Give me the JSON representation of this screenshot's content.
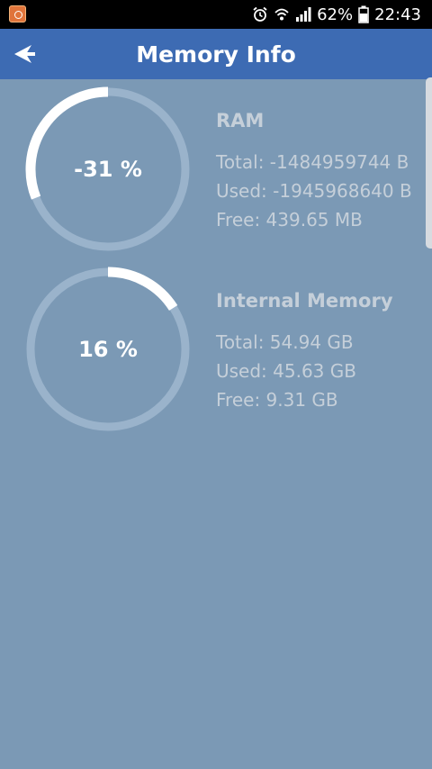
{
  "status_bar": {
    "battery_percent": "62%",
    "time": "22:43",
    "icons": [
      "app-notification-icon",
      "alarm-icon",
      "wifi-icon",
      "signal-icon",
      "battery-icon"
    ]
  },
  "app_bar": {
    "title": "Memory Info",
    "back_icon": "back-arrow-icon"
  },
  "ram": {
    "title": "RAM",
    "percent_label": "-31 %",
    "total": "Total: -1484959744 B",
    "used": "Used: -1945968640 B",
    "free": "Free: 439.65 MB",
    "gauge_fill_fraction": 0.31,
    "gauge_direction": "counterclockwise"
  },
  "internal_memory": {
    "title": "Internal Memory",
    "percent_label": "16 %",
    "total": "Total: 54.94 GB",
    "used": "Used: 45.63 GB",
    "free": "Free: 9.31 GB",
    "gauge_fill_fraction": 0.16,
    "gauge_direction": "clockwise"
  },
  "colors": {
    "status_bar": "#000000",
    "app_bar": "#3d6bb3",
    "background": "#7b99b5",
    "gauge_track": "#9ab3cb",
    "gauge_fill": "#ffffff",
    "info_text": "#c5cfd9"
  }
}
